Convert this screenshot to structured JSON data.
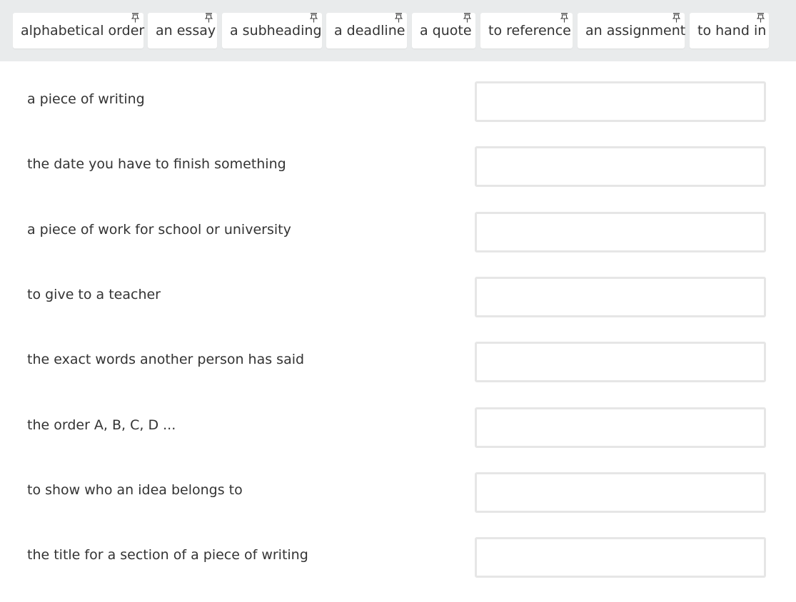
{
  "word_bank": {
    "chips": [
      {
        "label": "alphabetical order",
        "icon": "pin-icon"
      },
      {
        "label": "an essay",
        "icon": "pin-icon"
      },
      {
        "label": "a subheading",
        "icon": "pin-icon"
      },
      {
        "label": "a deadline",
        "icon": "pin-icon"
      },
      {
        "label": "a quote",
        "icon": "pin-icon"
      },
      {
        "label": "to reference",
        "icon": "pin-icon"
      },
      {
        "label": "an assignment",
        "icon": "pin-icon"
      },
      {
        "label": "to hand in",
        "icon": "pin-icon"
      }
    ],
    "background_color": "#e9ebec"
  },
  "definitions": [
    {
      "text": "a piece of writing",
      "answer": ""
    },
    {
      "text": "the date you have to finish something",
      "answer": ""
    },
    {
      "text": "a piece of work for school or university",
      "answer": ""
    },
    {
      "text": "to give to a teacher",
      "answer": ""
    },
    {
      "text": "the exact words another person has said",
      "answer": ""
    },
    {
      "text": "the order A, B, C, D ...",
      "answer": ""
    },
    {
      "text": "to show who an idea belongs to",
      "answer": ""
    },
    {
      "text": "the title for a section of a piece of writing",
      "answer": ""
    }
  ]
}
